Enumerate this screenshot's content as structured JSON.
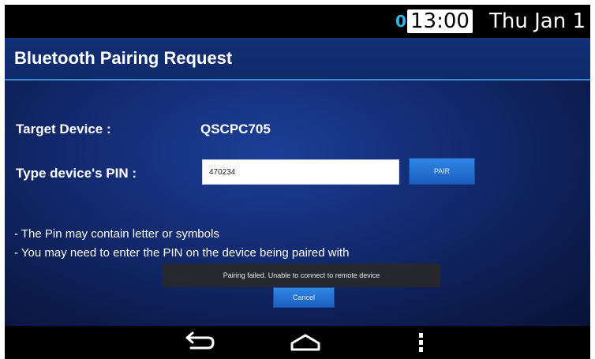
{
  "status_bar": {
    "notification_count": "0",
    "time": "13:00",
    "date": "Thu Jan 1"
  },
  "dialog": {
    "title": "Bluetooth Pairing Request",
    "target_label": "Target Device :",
    "target_value": "QSCPC705",
    "pin_label": "Type device's PIN :",
    "pin_value": "470234",
    "pair_label": "PAIR",
    "hints": [
      "- The Pin may contain letter or symbols",
      "- You may need to enter the PIN on the device being paired with"
    ],
    "cancel_label": "Cancel"
  },
  "toast": {
    "message": "Pairing failed. Unable to connect to remote device"
  },
  "nav_bar": {
    "icons": [
      "back-icon",
      "home-icon",
      "menu-icon"
    ]
  },
  "colors": {
    "accent": "#2f86e6",
    "background_dark": "#0b1a48",
    "notification": "#2fb6e6"
  }
}
